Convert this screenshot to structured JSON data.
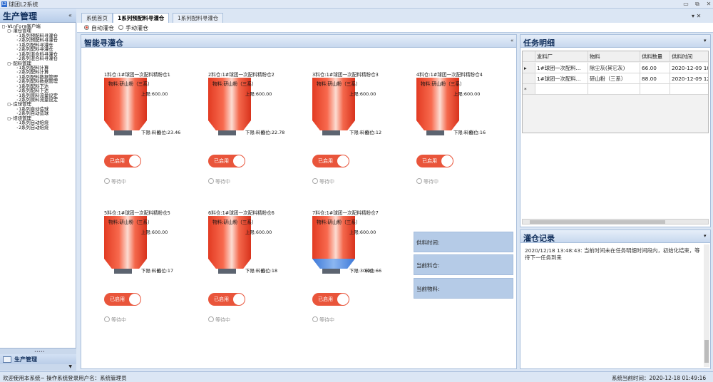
{
  "window": {
    "title": "球团L2系统",
    "icon": "L2"
  },
  "sidebar": {
    "title": "生产管理",
    "tree": [
      "□-WinForm客户端",
      "  □-灌仓管理",
      "     ·1系列预配料寻灌仓",
      "     ·2系列预配料寻灌仓",
      "     ·1系列配料寻灌仓",
      "     ·2系列配料寻灌仓",
      "     ·1系列混合料寻灌仓",
      "     ·2系列混合料寻灌仓",
      "  □-配料管理",
      "     ·1系列配料计算",
      "     ·2系列配料计算",
      "     ·1系列配料数据管理",
      "     ·2系列配料数据管理",
      "     ·1系列配料下达",
      "     ·2系列配料下达",
      "     ·1系列原料流量设定",
      "     ·2系列原料流量设定",
      "  □-造球管理",
      "     ·1系列自动造球",
      "     ·2系列自动造球",
      "  □-焙烧管理",
      "     ·1系列自动焙烧",
      "     ·2系列自动焙烧"
    ],
    "footer_label": "生产管理"
  },
  "tabs": [
    {
      "label": "系统首页",
      "active": false
    },
    {
      "label": "1系列预配料寻灌仓",
      "active": true
    },
    {
      "label": "1系列配料寻灌仓",
      "active": false
    }
  ],
  "mode": {
    "auto": "自动灌仓",
    "manual": "手动灌仓",
    "selected": "auto"
  },
  "panel": {
    "title": "智能寻灌仓"
  },
  "bins": [
    {
      "title": "1料仓:1#球团一次配料精粉仓1",
      "material": "物料:研山粉（三系）",
      "upper": "上限:600.00",
      "lower": "下限:料位",
      "level": "料位:23.46",
      "toggle": "已启用",
      "status": "等待中",
      "low": false
    },
    {
      "title": "2料仓:1#球团一次配料精粉仓2",
      "material": "物料:研山粉（三系）",
      "upper": "上限:600.00",
      "lower": "下限:料位",
      "level": "料位:22.78",
      "toggle": "已启用",
      "status": "等待中",
      "low": false
    },
    {
      "title": "3料仓:1#球团一次配料精粉仓3",
      "material": "物料:研山粉（三系）",
      "upper": "上限:600.00",
      "lower": "下限:料位",
      "level": "料位:12",
      "toggle": "已启用",
      "status": "等待中",
      "low": false
    },
    {
      "title": "4料仓:1#球团一次配料精粉仓4",
      "material": "物料:研山粉（三系）",
      "upper": "上限:600.00",
      "lower": "下限:料位",
      "level": "料位:16",
      "toggle": "已启用",
      "status": "等待中",
      "low": false
    },
    {
      "title": "5料仓:1#球团一次配料精粉仓5",
      "material": "物料:研山粉（三系）",
      "upper": "上限:600.00",
      "lower": "下限:料位",
      "level": "料位:17",
      "toggle": "已启用",
      "status": "等待中",
      "low": false
    },
    {
      "title": "6料仓:1#球团一次配料精粉仓6",
      "material": "物料:研山粉（三系）",
      "upper": "上限:600.00",
      "lower": "下限:料位",
      "level": "料位:18",
      "toggle": "已启用",
      "status": "等待中",
      "low": false
    },
    {
      "title": "7料仓:1#球团一次配料精粉仓7",
      "material": "物料:研山粉（三系）",
      "upper": "上限:600.00",
      "lower": "下限:30.00",
      "level": "料位:66",
      "toggle": "已启用",
      "status": "等待中",
      "low": true
    }
  ],
  "info": {
    "supply_time": "供料时间:",
    "current_bin": "当前料仓:",
    "current_material": "当前物料:"
  },
  "task": {
    "title": "任务明细",
    "columns": [
      "发料厂",
      "物料",
      "供料数量",
      "供料时间"
    ],
    "rows": [
      [
        "1#球团一次配料...",
        "除尘灰(其它灰)",
        "66.00",
        "2020-12-09 10"
      ],
      [
        "1#球团一次配料...",
        "研山粉（三系）",
        "88.00",
        "2020-12-09 12"
      ]
    ],
    "new_row_marker": "*"
  },
  "log": {
    "title": "灌仓记录",
    "text": "2020/12/18 13:48:43: 当前时间未在任务明细时间段内，初始化结束，等待下一任务到来"
  },
  "status": {
    "left": "欢迎使用本系统~  操作系统登录用户名：系统管理员",
    "right": "系统当前时间：2020-12-18 01:49:16"
  },
  "colors": {
    "accent": "#e9553b",
    "bin_red": "#e23b22",
    "panel_blue": "#b5cbe7",
    "title_blue": "#0f2d5a"
  }
}
